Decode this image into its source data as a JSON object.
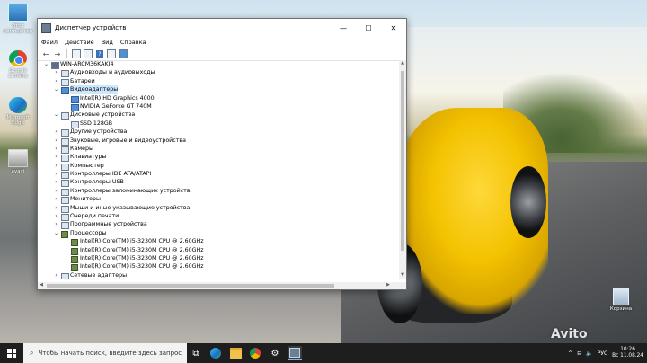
{
  "desktop": {
    "icons": [
      {
        "label": "Этот компьютер",
        "icon": "computer-icon"
      },
      {
        "label": "Google Chrome",
        "icon": "chrome-icon"
      },
      {
        "label": "Microsoft Edge",
        "icon": "edge-icon"
      },
      {
        "label": "avast",
        "icon": "screenshot-icon"
      }
    ],
    "recycle_bin": "Корзина",
    "watermark": "Avito"
  },
  "window": {
    "title": "Диспетчер устройств",
    "controls": {
      "minimize": "—",
      "maximize": "☐",
      "close": "✕"
    },
    "menu": [
      "Файл",
      "Действие",
      "Вид",
      "Справка"
    ],
    "toolbar": [
      "back-icon",
      "forward-icon",
      "properties-icon",
      "scan-icon",
      "help-icon",
      "view-icon",
      "monitor-icon"
    ]
  },
  "tree": [
    {
      "level": 0,
      "toggle": "⌄",
      "label": "WIN-ARCM36KAKI4",
      "icon": "root"
    },
    {
      "level": 1,
      "toggle": "›",
      "label": "Аудиовходы и аудиовыходы"
    },
    {
      "level": 1,
      "toggle": "›",
      "label": "Батареи"
    },
    {
      "level": 1,
      "toggle": "⌄",
      "label": "Видеоадаптеры",
      "icon": "monitor",
      "selected": true
    },
    {
      "level": 2,
      "toggle": "",
      "label": "Intel(R) HD Graphics 4000",
      "icon": "monitor"
    },
    {
      "level": 2,
      "toggle": "",
      "label": "NVIDIA GeForce GT 740M",
      "icon": "monitor"
    },
    {
      "level": 1,
      "toggle": "⌄",
      "label": "Дисковые устройства"
    },
    {
      "level": 2,
      "toggle": "",
      "label": "SSD 128GB"
    },
    {
      "level": 1,
      "toggle": "›",
      "label": "Другие устройства"
    },
    {
      "level": 1,
      "toggle": "›",
      "label": "Звуковые, игровые и видеоустройства"
    },
    {
      "level": 1,
      "toggle": "›",
      "label": "Камеры"
    },
    {
      "level": 1,
      "toggle": "›",
      "label": "Клавиатуры"
    },
    {
      "level": 1,
      "toggle": "›",
      "label": "Компьютер"
    },
    {
      "level": 1,
      "toggle": "›",
      "label": "Контроллеры IDE ATA/ATAPI"
    },
    {
      "level": 1,
      "toggle": "›",
      "label": "Контроллеры USB"
    },
    {
      "level": 1,
      "toggle": "›",
      "label": "Контроллеры запоминающих устройств"
    },
    {
      "level": 1,
      "toggle": "›",
      "label": "Мониторы"
    },
    {
      "level": 1,
      "toggle": "›",
      "label": "Мыши и иные указывающие устройства"
    },
    {
      "level": 1,
      "toggle": "›",
      "label": "Очереди печати"
    },
    {
      "level": 1,
      "toggle": "›",
      "label": "Программные устройства"
    },
    {
      "level": 1,
      "toggle": "⌄",
      "label": "Процессоры",
      "icon": "cpu"
    },
    {
      "level": 2,
      "toggle": "",
      "label": "Intel(R) Core(TM) i5-3230M CPU @ 2.60GHz",
      "icon": "cpu"
    },
    {
      "level": 2,
      "toggle": "",
      "label": "Intel(R) Core(TM) i5-3230M CPU @ 2.60GHz",
      "icon": "cpu"
    },
    {
      "level": 2,
      "toggle": "",
      "label": "Intel(R) Core(TM) i5-3230M CPU @ 2.60GHz",
      "icon": "cpu"
    },
    {
      "level": 2,
      "toggle": "",
      "label": "Intel(R) Core(TM) i5-3230M CPU @ 2.60GHz",
      "icon": "cpu"
    },
    {
      "level": 1,
      "toggle": "›",
      "label": "Сетевые адаптеры"
    }
  ],
  "taskbar": {
    "search_placeholder": "Чтобы начать поиск, введите здесь запрос",
    "apps": [
      "task-view-icon",
      "edge-icon",
      "explorer-icon",
      "chrome-icon",
      "settings-icon",
      "device-manager-icon"
    ],
    "tray": {
      "chevron": "^",
      "network": "⊟",
      "volume": "🔈",
      "lang": "РУС"
    },
    "time": "10:26",
    "date": "Вс 11.08.24"
  }
}
